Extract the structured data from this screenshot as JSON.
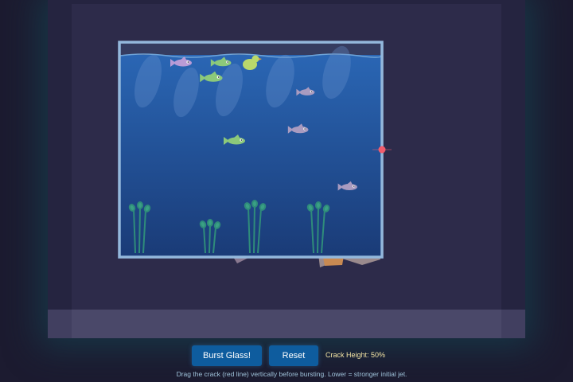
{
  "controls": {
    "burst_label": "Burst Glass!",
    "reset_label": "Reset",
    "crack_height_prefix": "Crack Height: ",
    "crack_height_value": "50%"
  },
  "hint": "Drag the crack (red line) vertically before bursting. Lower = stronger initial jet.",
  "scene": {
    "crack_height_percent": 50,
    "fish": [
      {
        "name": "fish-1",
        "color": "#b99bd6"
      },
      {
        "name": "fish-2",
        "color": "#8cc97a"
      },
      {
        "name": "fish-3",
        "color": "#8cc97a"
      },
      {
        "name": "fish-4",
        "color": "#a99bc0"
      },
      {
        "name": "fish-5",
        "color": "#a99bc0"
      },
      {
        "name": "fish-6",
        "color": "#8cc97a"
      },
      {
        "name": "fish-7",
        "color": "#a99bc0"
      }
    ],
    "duck_color": "#b9d86b",
    "crack_marker_color": "#f25c6c",
    "water_top_color": "#2a66b4",
    "water_bottom_color": "#1a3b77",
    "glass_frame_color": "#93b8dc"
  }
}
